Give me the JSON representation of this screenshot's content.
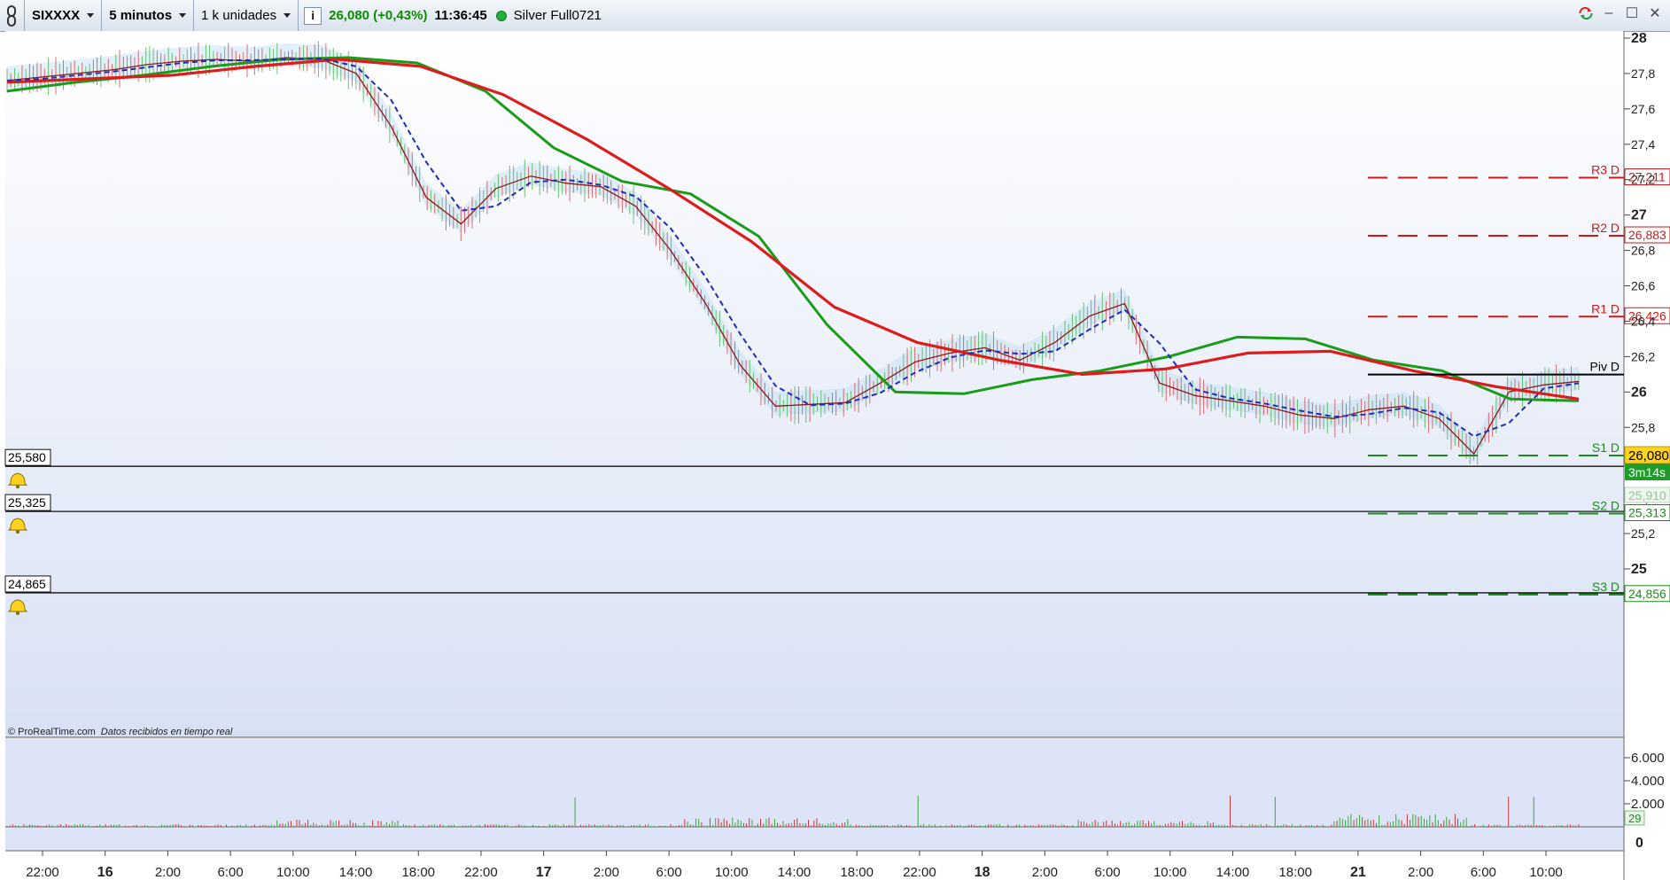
{
  "toolbar": {
    "symbol": "SIXXXX",
    "timeframe": "5 minutos",
    "units": "1 k unidades",
    "info_icon": "info-icon",
    "price_change": "26,080 (+0,43%)",
    "time": "11:36:45",
    "account": "Silver Full0721"
  },
  "footer": {
    "source": "© ProRealTime.com",
    "status": "Datos recibidos en tiempo real"
  },
  "colors": {
    "ema_fast": "#1a9c1a",
    "ema_slow": "#dd1c1c",
    "price": "#8b1a1a",
    "dashed_blue": "#1e2dbd",
    "resistance": "#cc1a1a",
    "support": "#1e8a1e"
  },
  "chart_data": {
    "type": "line",
    "x_ticks": [
      "22:00",
      "16",
      "2:00",
      "6:00",
      "10:00",
      "14:00",
      "18:00",
      "22:00",
      "17",
      "2:00",
      "6:00",
      "10:00",
      "14:00",
      "18:00",
      "22:00",
      "18",
      "2:00",
      "6:00",
      "10:00",
      "14:00",
      "18:00",
      "21",
      "2:00",
      "6:00",
      "10:00"
    ],
    "y_ticks": [
      "28",
      "27,8",
      "27,6",
      "27,4",
      "27,2",
      "27",
      "26,8",
      "26,6",
      "26,4",
      "26,2",
      "26",
      "25,8",
      "25,6",
      "25,4",
      "25,2",
      "25"
    ],
    "ylim": [
      24.85,
      28.08
    ],
    "series": [
      {
        "name": "",
        "kind": "price",
        "values": [
          27.76,
          27.78,
          27.8,
          27.82,
          27.85,
          27.87,
          27.88,
          27.87,
          27.89,
          27.88,
          27.8,
          27.5,
          27.1,
          26.95,
          27.15,
          27.22,
          27.18,
          27.16,
          27.05,
          26.8,
          26.5,
          26.15,
          25.92,
          25.93,
          25.94,
          26.05,
          26.17,
          26.22,
          26.25,
          26.18,
          26.28,
          26.43,
          26.5,
          26.05,
          25.98,
          25.95,
          25.92,
          25.87,
          25.85,
          25.9,
          25.92,
          25.85,
          25.65,
          26.0,
          26.04,
          26.06
        ]
      },
      {
        "name": "",
        "kind": "ema_fast",
        "values": [
          27.7,
          27.75,
          27.79,
          27.84,
          27.88,
          27.89,
          27.86,
          27.7,
          27.38,
          27.19,
          27.12,
          26.88,
          26.38,
          26.0,
          25.99,
          26.07,
          26.12,
          26.2,
          26.31,
          26.3,
          26.18,
          26.12,
          25.96,
          25.95
        ]
      },
      {
        "name": "",
        "kind": "ema_slow",
        "values": [
          27.75,
          27.77,
          27.79,
          27.84,
          27.88,
          27.84,
          27.68,
          27.43,
          27.15,
          26.85,
          26.48,
          26.28,
          26.18,
          26.1,
          26.13,
          26.22,
          26.23,
          26.12,
          26.03,
          25.96
        ]
      }
    ],
    "pivots": [
      {
        "label": "R3 D",
        "value": "27,211"
      },
      {
        "label": "R2 D",
        "value": "26,883"
      },
      {
        "label": "R1 D",
        "value": "26,426"
      },
      {
        "label": "Piv D",
        "value": "26,099"
      },
      {
        "label": "S1 D",
        "value": "25,641"
      },
      {
        "label": "S2 D",
        "value": "25,313"
      },
      {
        "label": "S3 D",
        "value": "24,856"
      }
    ],
    "alerts": [
      "25,580",
      "25,325",
      "24,865"
    ],
    "current_price_label": "26,080",
    "countdown_label": "3m14s",
    "secondary_label": "25,910",
    "volume": {
      "y_ticks": [
        "6.000",
        "4.000",
        "2.000",
        "0"
      ],
      "last_value": "29"
    }
  }
}
